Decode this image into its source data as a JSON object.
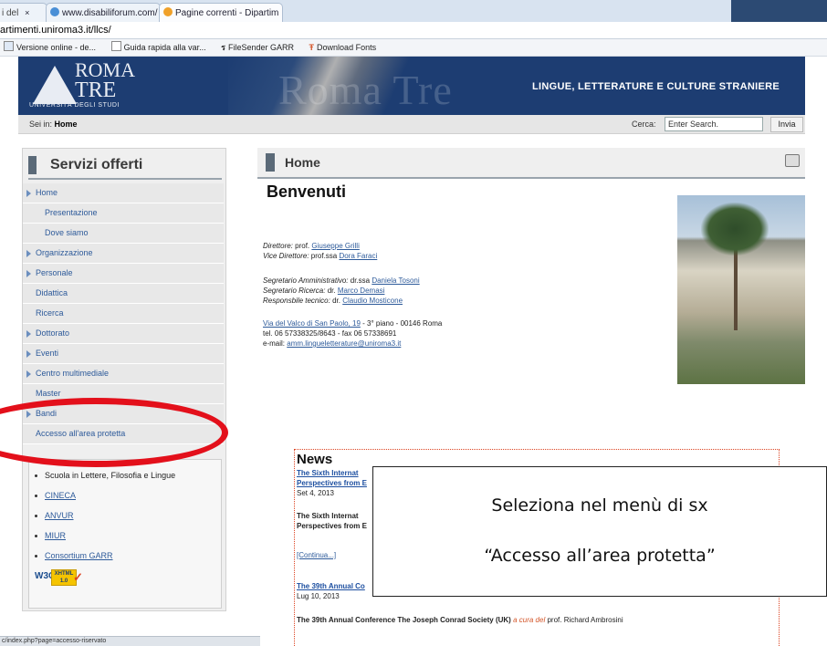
{
  "browser": {
    "tabs": [
      {
        "label": "i del"
      },
      {
        "label": "www.disabiliforum.com/"
      },
      {
        "label": "Pagine correnti - Dipartim"
      }
    ],
    "address": "artimenti.uniroma3.it/llcs/",
    "bookmarks": [
      "Versione online - de...",
      "Guida rapida alla var...",
      "FileSender GARR",
      "Download Fonts"
    ],
    "status": "c/index.php?page=accesso-riservato"
  },
  "banner": {
    "logo_roma": "ROMA",
    "logo_tre": "TRE",
    "logo_sub": "UNIVERSITÀ DEGLI STUDI",
    "watermark": "Roma Tre",
    "dept_title": "LINGUE, LETTERATURE E CULTURE STRANIERE"
  },
  "crumb": {
    "prefix": "Sei in:",
    "current": "Home",
    "search_label": "Cerca:",
    "search_value": "Enter Search.",
    "search_button": "Invia"
  },
  "sidebar": {
    "title": "Servizi offerti",
    "items": [
      {
        "label": "Home",
        "arrow": true
      },
      {
        "label": "Presentazione",
        "sub": true
      },
      {
        "label": "Dove siamo",
        "sub": true
      },
      {
        "label": "Organizzazione",
        "arrow": true
      },
      {
        "label": "Personale",
        "arrow": true
      },
      {
        "label": "Didattica"
      },
      {
        "label": "Ricerca"
      },
      {
        "label": "Dottorato",
        "arrow": true
      },
      {
        "label": "Eventi",
        "arrow": true
      },
      {
        "label": "Centro multimediale",
        "arrow": true
      },
      {
        "label": "Master"
      },
      {
        "label": "Bandi",
        "arrow": true
      },
      {
        "label": "Accesso all'area protetta"
      }
    ],
    "links": [
      {
        "label": "Scuola in Lettere, Filosofia e Lingue"
      },
      {
        "label": "CINECA"
      },
      {
        "label": "ANVUR"
      },
      {
        "label": "MIUR"
      },
      {
        "label": "Consortium GARR"
      }
    ],
    "w3c": {
      "w": "W3C",
      "badge_top": "XHTML",
      "badge_bottom": "1.0"
    }
  },
  "main": {
    "title": "Home",
    "welcome": "Benvenuti",
    "direttore_label": "Direttore:",
    "direttore_title": "prof.",
    "direttore_name": "Giuseppe Grilli",
    "vice_label": "Vice Direttore:",
    "vice_title": "prof.ssa",
    "vice_name": "Dora Faraci",
    "segr_amm_label": "Segretario Amministrativo:",
    "segr_amm_title": "dr.ssa",
    "segr_amm_name": "Daniela Tosoni",
    "segr_ric_label": "Segretario Ricerca:",
    "segr_ric_title": "dr.",
    "segr_ric_name": "Marco Demasi",
    "resp_label": "Responsbile tecnico:",
    "resp_title": "dr.",
    "resp_name": "Claudio Mosticone",
    "address_link": "Via del Valco di San Paolo, 19",
    "address_rest": "- 3° piano - 00146 Roma",
    "phone": "tel. 06 57338325/8643 - fax 06 57338691",
    "email_label": "e-mail:",
    "email": "amm.lingueletterature@uniroma3.it"
  },
  "news": {
    "title": "News",
    "n1_title_a": "The Sixth Internat",
    "n1_title_b": "Perspectives from E",
    "n1_date": "Set 4, 2013",
    "n1_body_a": "The Sixth Internat",
    "n1_body_b": "Perspectives from E",
    "continua": "[Continua...]",
    "n2_title": "The 39th Annual Co",
    "n2_date": "Lug 10, 2013",
    "n2_body": "The 39th Annual Conference The Joseph Conrad Society (UK)",
    "n2_curadel": "a cura del",
    "n2_prof": "prof. Richard Ambrosini"
  },
  "callout": {
    "line1": "Seleziona  nel menù di sx",
    "line2": "“Accesso all’area protetta”"
  },
  "colors": {
    "banner": "#1d3d72",
    "link": "#2d5a9a",
    "highlight_oval": "#e3101b",
    "news_border": "#d42"
  }
}
